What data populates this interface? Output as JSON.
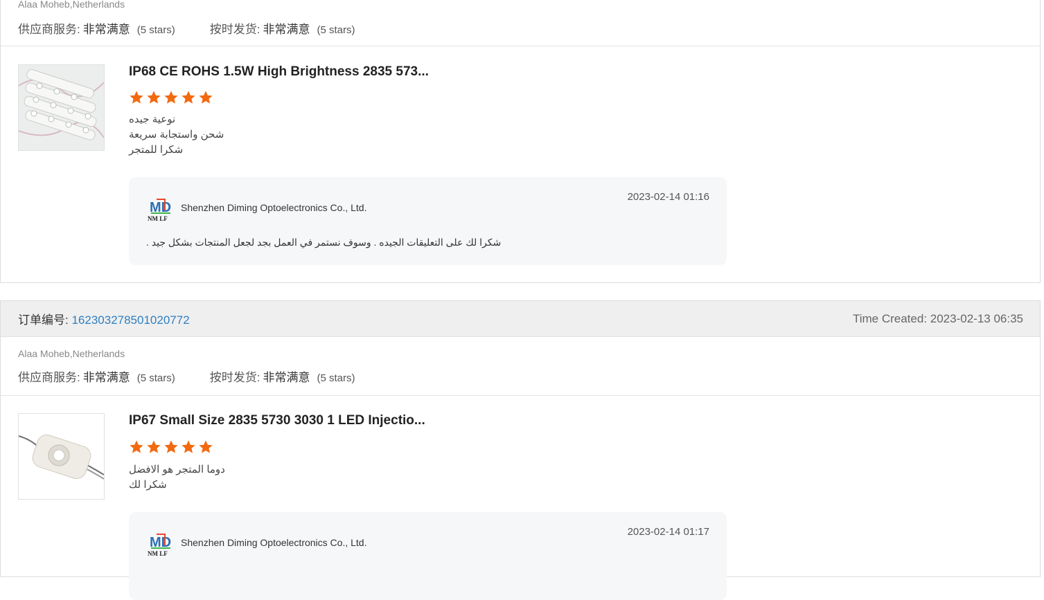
{
  "orders": [
    {
      "buyer": "Alaa Moheb,Netherlands",
      "supplier_service_label": "供应商服务:",
      "supplier_service_value": "非常满意",
      "supplier_service_stars": "(5 stars)",
      "ontime_label": "按时发货:",
      "ontime_value": "非常满意",
      "ontime_stars": "(5 stars)",
      "product": {
        "title": "IP68 CE ROHS 1.5W High Brightness 2835 573...",
        "rating": 5,
        "review_lines": [
          "نوعية جيده",
          "شحن واستجابة سريعة",
          "شكرا للمتجر"
        ],
        "reply": {
          "company": "Shenzhen Diming Optoelectronics Co., Ltd.",
          "time": "2023-02-14 01:16",
          "text": "شكرا لك على التعليقات الجيده . وسوف نستمر في العمل بجد لجعل المنتجات بشكل جيد ."
        }
      }
    },
    {
      "order_label": "订单编号:",
      "order_number": "162303278501020772",
      "time_created": "Time Created: 2023-02-13 06:35",
      "buyer": "Alaa Moheb,Netherlands",
      "supplier_service_label": "供应商服务:",
      "supplier_service_value": "非常满意",
      "supplier_service_stars": "(5 stars)",
      "ontime_label": "按时发货:",
      "ontime_value": "非常满意",
      "ontime_stars": "(5 stars)",
      "product": {
        "title": "IP67 Small Size 2835 5730 3030 1 LED Injectio...",
        "rating": 5,
        "review_lines": [
          "دوما المتجر هو الافضل",
          "شكرا لك"
        ],
        "reply": {
          "company": "Shenzhen Diming Optoelectronics Co., Ltd.",
          "time": "2023-02-14 01:17",
          "text": ""
        }
      }
    }
  ],
  "colors": {
    "star": "#f26a10",
    "order_link": "#2f7fc1"
  },
  "logo_text": "MD",
  "logo_sub": "NM LF"
}
